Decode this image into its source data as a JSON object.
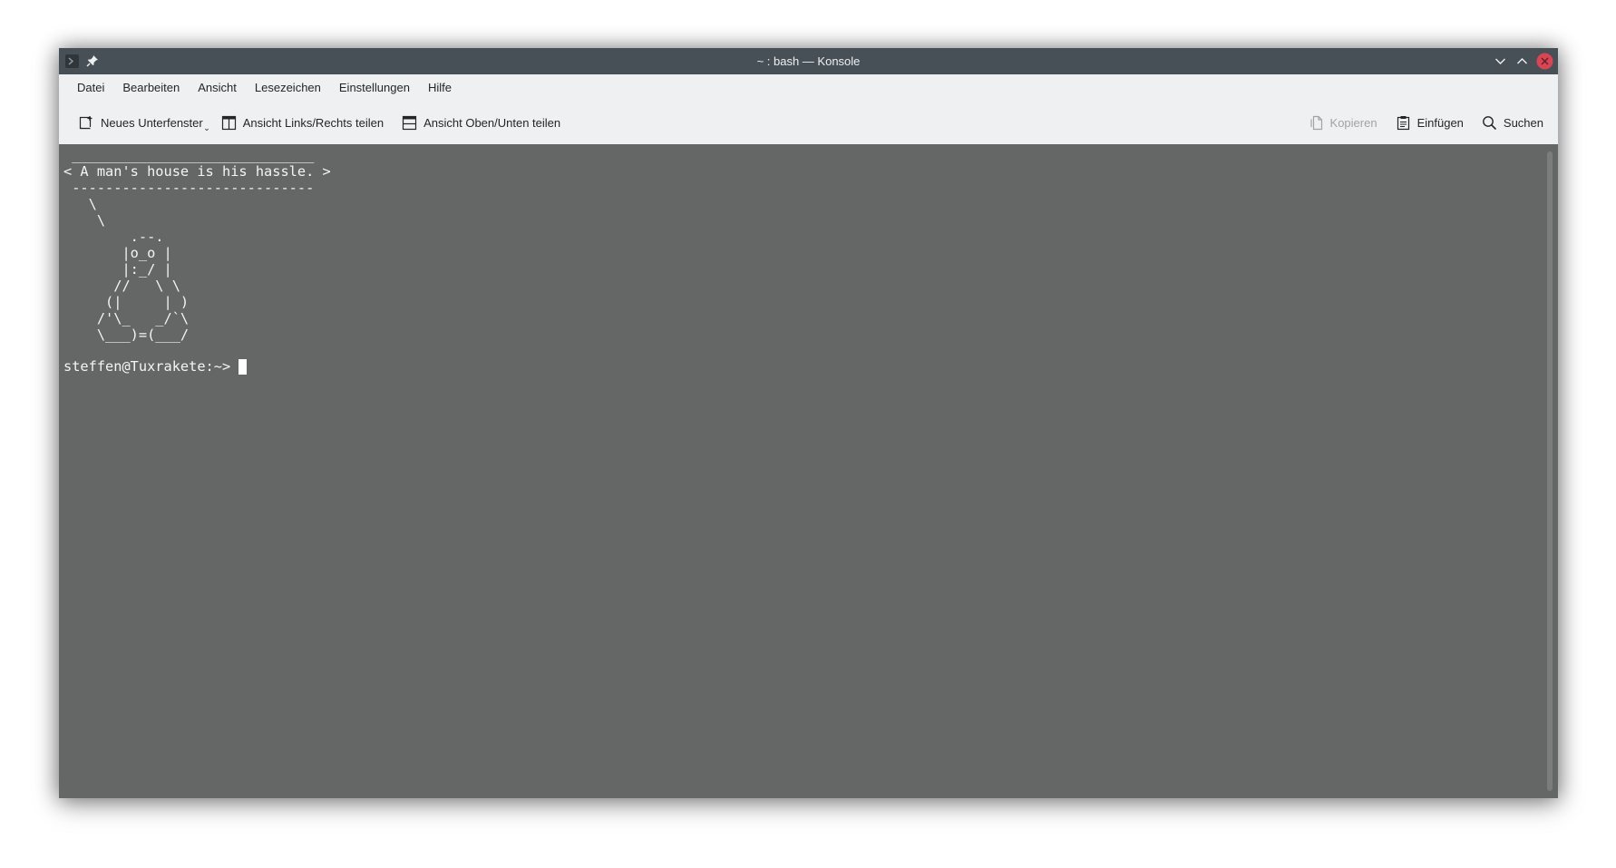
{
  "window": {
    "title": "~ : bash — Konsole"
  },
  "menubar": {
    "items": [
      "Datei",
      "Bearbeiten",
      "Ansicht",
      "Lesezeichen",
      "Einstellungen",
      "Hilfe"
    ]
  },
  "toolbar": {
    "new_tab_label": "Neues Unterfenster",
    "split_lr_label": "Ansicht Links/Rechts teilen",
    "split_tb_label": "Ansicht Oben/Unten teilen",
    "copy_label": "Kopieren",
    "paste_label": "Einfügen",
    "search_label": "Suchen"
  },
  "terminal": {
    "output": " _____________________________\n< A man's house is his hassle. >\n -----------------------------\n   \\\n    \\\n        .--.\n       |o_o |\n       |:_/ |\n      //   \\ \\\n     (|     | )\n    /'\\_   _/`\\\n    \\___)=(___/",
    "prompt": "steffen@Tuxrakete:~>"
  },
  "icons": {
    "app": "terminal-icon",
    "pin": "pin-icon",
    "minimize": "chevron-down-icon",
    "maximize": "chevron-up-icon",
    "close": "close-icon",
    "new_tab": "new-tab-icon",
    "split_lr": "split-horizontal-icon",
    "split_tb": "split-vertical-icon",
    "copy": "copy-icon",
    "paste": "paste-icon",
    "search": "search-icon"
  },
  "colors": {
    "titlebar": "#475057",
    "terminal_bg": "#656766",
    "terminal_fg": "#f4f4f4",
    "close_button": "#da4453"
  }
}
